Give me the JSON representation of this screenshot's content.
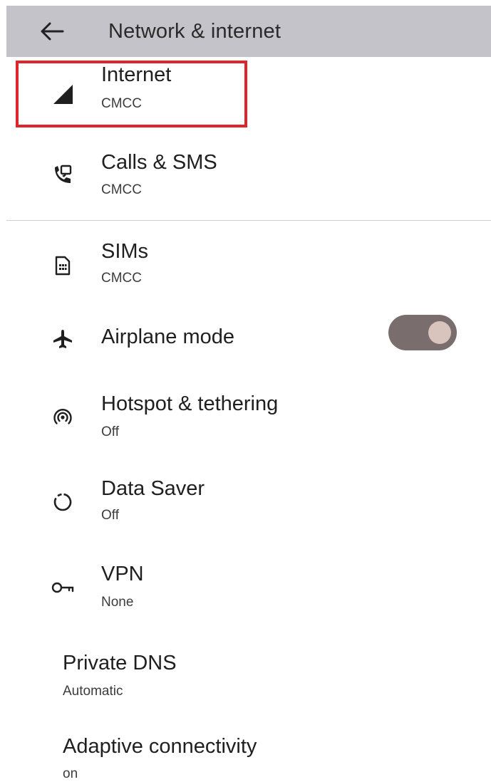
{
  "header": {
    "title": "Network & internet"
  },
  "items": [
    {
      "title": "Internet",
      "subtitle": "CMCC",
      "icon": "signal-icon"
    },
    {
      "title": "Calls & SMS",
      "subtitle": "CMCC",
      "icon": "calls-sms-icon"
    },
    {
      "title": "SIMs",
      "subtitle": "CMCC",
      "icon": "sim-card-icon"
    },
    {
      "title": "Airplane mode",
      "icon": "airplane-icon",
      "toggle_on": true
    },
    {
      "title": "Hotspot & tethering",
      "subtitle": "Off",
      "icon": "hotspot-icon"
    },
    {
      "title": "Data Saver",
      "subtitle": "Off",
      "icon": "data-saver-icon"
    },
    {
      "title": "VPN",
      "subtitle": "None",
      "icon": "vpn-key-icon"
    },
    {
      "title": "Private DNS",
      "subtitle": "Automatic"
    },
    {
      "title": "Adaptive connectivity",
      "subtitle": "on"
    }
  ],
  "colors": {
    "header_bg": "#c3c3c9",
    "highlight": "#e0242b",
    "toggle_track": "#7a6d6d",
    "toggle_knob": "#d9c3bd"
  }
}
